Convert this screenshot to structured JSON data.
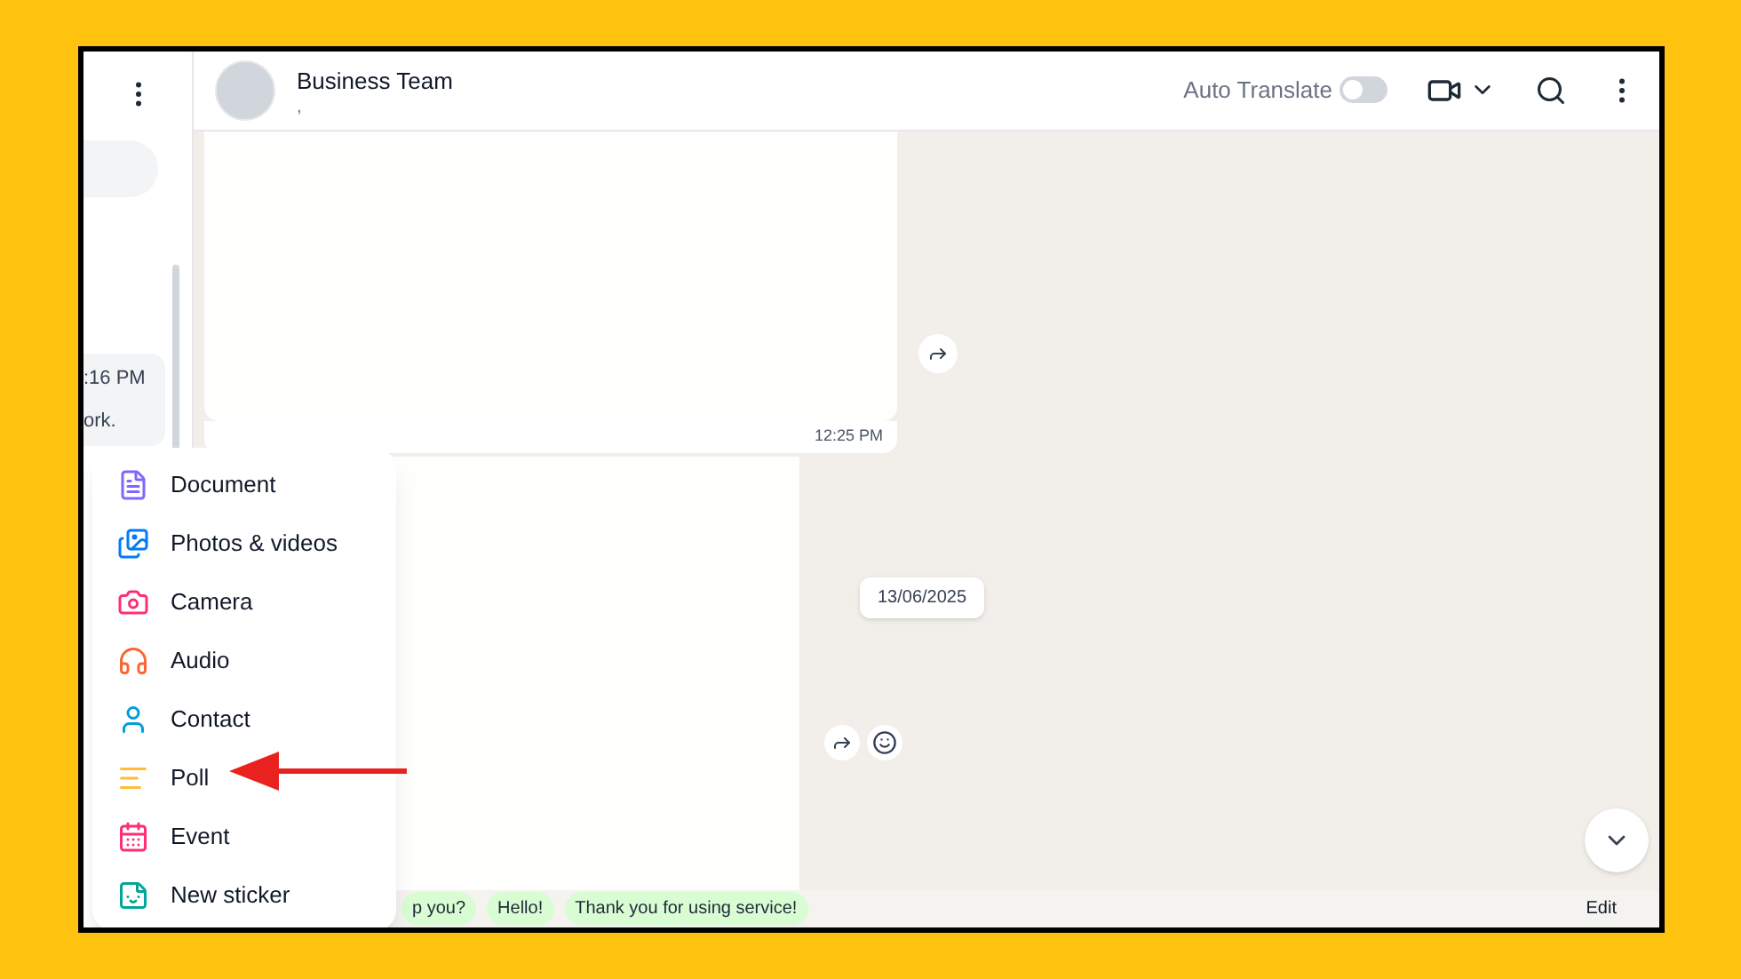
{
  "sidebar": {
    "preview_time": ":16 PM",
    "preview_text": "ork."
  },
  "chat": {
    "title": "Business Team",
    "subtitle": ",",
    "auto_translate": {
      "label": "Auto Translate",
      "on": false
    }
  },
  "messages": [
    {
      "time": "12:25 PM"
    }
  ],
  "date_chip": "13/06/2025",
  "attach_menu": [
    {
      "kind": "document",
      "label": "Document",
      "color": "#7f66ff"
    },
    {
      "kind": "photos",
      "label": "Photos & videos",
      "color": "#007bfc"
    },
    {
      "kind": "camera",
      "label": "Camera",
      "color": "#ff2e74"
    },
    {
      "kind": "audio",
      "label": "Audio",
      "color": "#fa6533"
    },
    {
      "kind": "contact",
      "label": "Contact",
      "color": "#009de2"
    },
    {
      "kind": "poll",
      "label": "Poll",
      "color": "#ffbc38"
    },
    {
      "kind": "event",
      "label": "Event",
      "color": "#ff2e74"
    },
    {
      "kind": "sticker",
      "label": "New sticker",
      "color": "#02a698"
    }
  ],
  "quick_replies": [
    "p you?",
    "Hello!",
    "Thank you for using service!"
  ],
  "edit": "Edit"
}
